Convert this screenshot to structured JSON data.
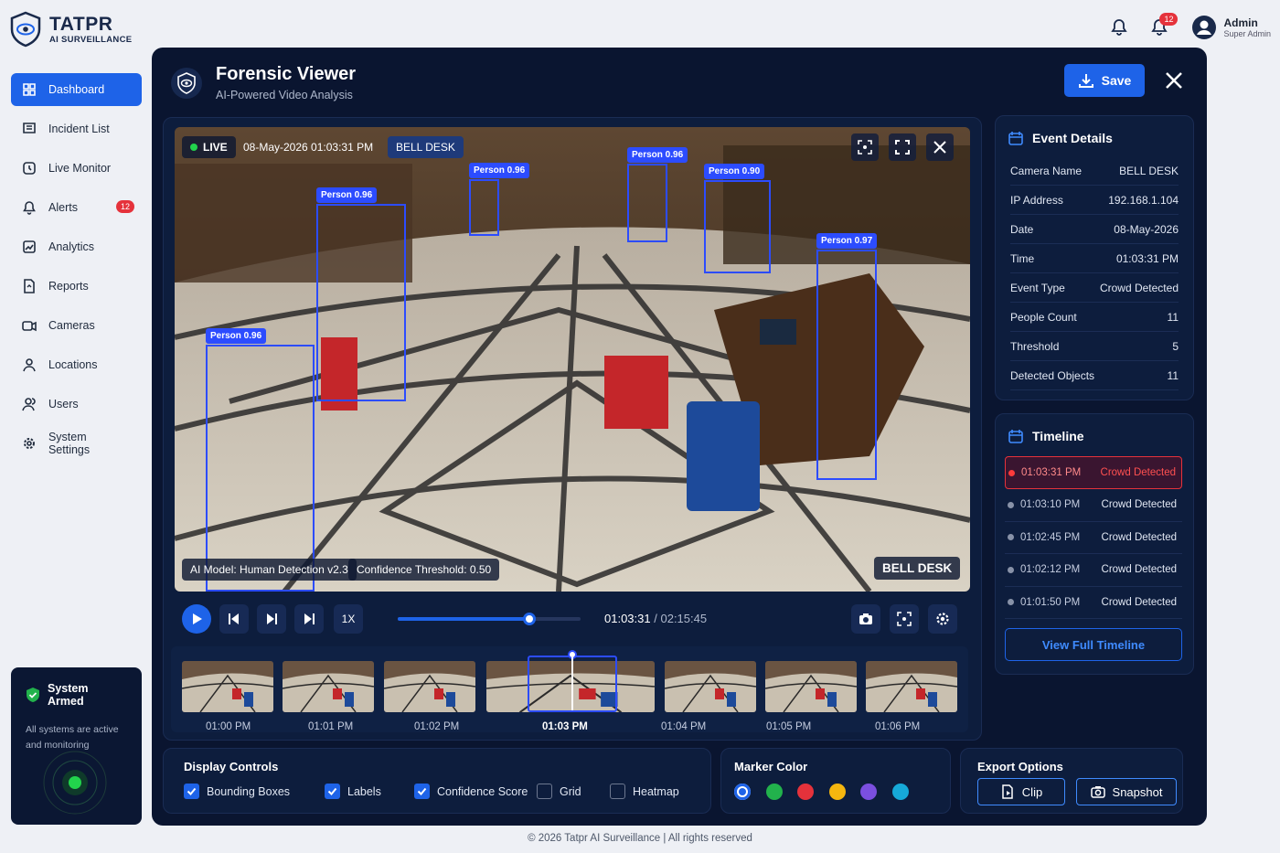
{
  "brand": {
    "name": "TATPR",
    "subtitle": "AI SURVEILLANCE"
  },
  "topbar": {
    "notif_count": "12",
    "user_name": "Admin",
    "user_role": "Super Admin"
  },
  "sidebar": {
    "items": [
      {
        "label": "Dashboard",
        "icon": "grid-icon"
      },
      {
        "label": "Incident List",
        "icon": "list-icon"
      },
      {
        "label": "Live Monitor",
        "icon": "monitor-icon"
      },
      {
        "label": "Alerts",
        "icon": "bell-icon",
        "count": "12"
      },
      {
        "label": "Analytics",
        "icon": "chart-icon"
      },
      {
        "label": "Reports",
        "icon": "report-icon"
      },
      {
        "label": "Cameras",
        "icon": "camera-icon"
      },
      {
        "label": "Locations",
        "icon": "location-icon"
      },
      {
        "label": "Users",
        "icon": "users-icon"
      },
      {
        "label": "System Settings",
        "icon": "gear-icon"
      }
    ],
    "armed": {
      "title": "System Armed",
      "desc": "All systems are active and monitoring"
    }
  },
  "header": {
    "title": "Forensic Viewer",
    "subtitle": "AI-Powered Video Analysis",
    "save": "Save"
  },
  "video": {
    "live": "LIVE",
    "timestamp": "08-May-2026 01:03:31 PM",
    "camera": "BELL DESK",
    "model": "AI Model: Human Detection v2.3",
    "threshold": "Confidence Threshold: 0.50",
    "camera_corner": "BELL DESK",
    "detections": [
      "Person 0.96",
      "Person 0.96",
      "Person 0.96",
      "Person 0.90",
      "Person 0.97",
      "Person 0.96"
    ]
  },
  "controls": {
    "speed": "1X",
    "current": "01:03:31",
    "separator": "/",
    "total": "02:15:45",
    "progress": 0.72
  },
  "thumbs": [
    "01:00 PM",
    "01:01 PM",
    "01:02 PM",
    "01:03 PM",
    "01:04 PM",
    "01:05 PM",
    "01:06 PM"
  ],
  "event": {
    "title": "Event Details",
    "rows": [
      [
        "Camera Name",
        "BELL DESK"
      ],
      [
        "IP Address",
        "192.168.1.104"
      ],
      [
        "Date",
        "08-May-2026"
      ],
      [
        "Time",
        "01:03:31 PM"
      ],
      [
        "Event Type",
        "Crowd Detected"
      ],
      [
        "People Count",
        "11"
      ],
      [
        "Threshold",
        "5"
      ],
      [
        "Detected Objects",
        "11"
      ]
    ]
  },
  "timeline": {
    "title": "Timeline",
    "rows": [
      [
        "01:03:31 PM",
        "Crowd Detected"
      ],
      [
        "01:03:10 PM",
        "Crowd Detected"
      ],
      [
        "01:02:45 PM",
        "Crowd Detected"
      ],
      [
        "01:02:12 PM",
        "Crowd Detected"
      ],
      [
        "01:01:50 PM",
        "Crowd Detected"
      ]
    ],
    "button": "View Full Timeline"
  },
  "display": {
    "title": "Display Controls",
    "options": [
      {
        "label": "Bounding Boxes",
        "checked": true
      },
      {
        "label": "Labels",
        "checked": true
      },
      {
        "label": "Confidence Score",
        "checked": true
      },
      {
        "label": "Grid",
        "checked": false
      },
      {
        "label": "Heatmap",
        "checked": false
      }
    ]
  },
  "marker": {
    "title": "Marker Color",
    "colors": [
      "#1e63e8",
      "#22b24c",
      "#e5323b",
      "#f5b60f",
      "#7b4fe0",
      "#16a9d8"
    ]
  },
  "export": {
    "title": "Export Options",
    "clip": "Clip",
    "snapshot": "Snapshot"
  },
  "footer": "© 2026 Tatpr AI Surveillance | All rights reserved"
}
